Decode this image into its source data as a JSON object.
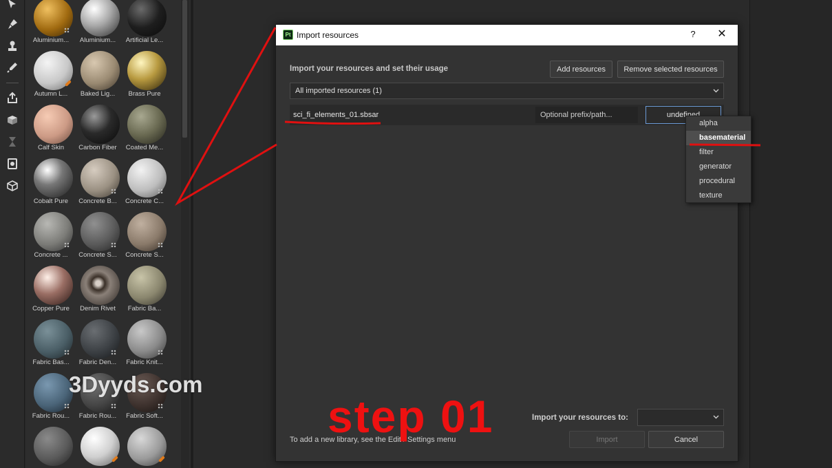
{
  "toolstrip": {
    "tools": [
      "select-icon",
      "paint-icon",
      "clone-stamp-icon",
      "picker-icon",
      "export-icon",
      "texture-set-icon",
      "hourglass-icon",
      "bake-icon",
      "cube-icon"
    ]
  },
  "shelf": {
    "materials": [
      {
        "label": "Aluminium...",
        "style": "gold-hex"
      },
      {
        "label": "Aluminium...",
        "style": "silver"
      },
      {
        "label": "Artificial Le...",
        "style": "black"
      },
      {
        "label": "Autumn L...",
        "style": "leaf"
      },
      {
        "label": "Baked Lig...",
        "style": "beige"
      },
      {
        "label": "Brass Pure",
        "style": "brass"
      },
      {
        "label": "Calf Skin",
        "style": "skin"
      },
      {
        "label": "Carbon Fiber",
        "style": "carbon"
      },
      {
        "label": "Coated Me...",
        "style": "olive"
      },
      {
        "label": "Cobalt Pure",
        "style": "chrome"
      },
      {
        "label": "Concrete B...",
        "style": "concrete-a"
      },
      {
        "label": "Concrete C...",
        "style": "concrete-c"
      },
      {
        "label": "Concrete ...",
        "style": "concrete-d"
      },
      {
        "label": "Concrete S...",
        "style": "concrete-e"
      },
      {
        "label": "Concrete S...",
        "style": "concrete-f"
      },
      {
        "label": "Copper Pure",
        "style": "copper"
      },
      {
        "label": "Denim Rivet",
        "style": "rivet"
      },
      {
        "label": "Fabric Ba...",
        "style": "fabric-khaki"
      },
      {
        "label": "Fabric Bas...",
        "style": "fabric-teal"
      },
      {
        "label": "Fabric Den...",
        "style": "fabric-dark"
      },
      {
        "label": "Fabric Knit...",
        "style": "fabric-grey"
      },
      {
        "label": "Fabric Rou...",
        "style": "fabric-blue"
      },
      {
        "label": "Fabric Rou...",
        "style": "fabric-charcoal"
      },
      {
        "label": "Fabric Soft...",
        "style": "fabric-brown"
      },
      {
        "label": "",
        "style": "mesh"
      },
      {
        "label": "",
        "style": "white-glossy"
      },
      {
        "label": "",
        "style": "speckled"
      }
    ]
  },
  "dialog": {
    "app_icon": "Pt",
    "title": "Import resources",
    "help": "?",
    "close": "✕",
    "heading": "Import your resources and set their usage",
    "add_button": "Add resources",
    "remove_button": "Remove selected resources",
    "filter_value": "All imported resources (1)",
    "resource": {
      "name": "sci_fi_elements_01.sbsar",
      "prefix_placeholder": "Optional prefix/path...",
      "usage": "undefined"
    },
    "import_to_label": "Import your resources to:",
    "hint": "To add a new library, see the Edit / Settings menu",
    "import_button": "Import",
    "cancel_button": "Cancel"
  },
  "usage_dropdown": {
    "options": [
      "alpha",
      "basematerial",
      "filter",
      "generator",
      "procedural",
      "texture"
    ],
    "highlighted": "basematerial"
  },
  "annotations": {
    "watermark": "3Dyyds.com",
    "step": "step 01",
    "color": "#ee1111"
  }
}
